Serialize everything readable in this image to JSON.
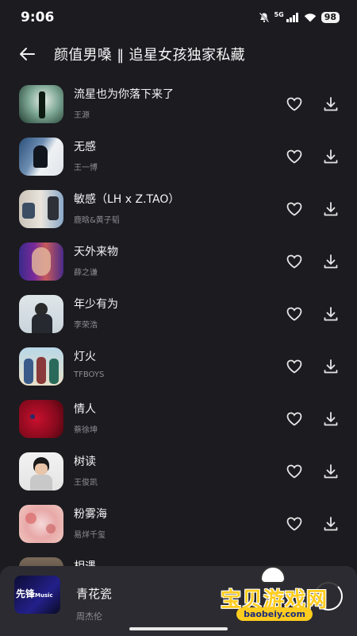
{
  "status_bar": {
    "time": "9:06",
    "network": "5G",
    "battery": "98",
    "icons": [
      "mute-bell-icon",
      "signal-icon",
      "wifi-icon",
      "battery-icon"
    ]
  },
  "header": {
    "back_icon": "arrow-left-icon",
    "title": "颜值男嗓 ‖ 追星女孩独家私藏"
  },
  "songs": [
    {
      "title": "流星也为你落下来了",
      "artist": "王源"
    },
    {
      "title": "无感",
      "artist": "王一博"
    },
    {
      "title": "敏感（LH x Z.TAO）",
      "artist": "鹿晗&黄子韬"
    },
    {
      "title": "天外来物",
      "artist": "薛之谦"
    },
    {
      "title": "年少有为",
      "artist": "李荣浩"
    },
    {
      "title": "灯火",
      "artist": "TFBOYS"
    },
    {
      "title": "情人",
      "artist": "蔡徐坤"
    },
    {
      "title": "树读",
      "artist": "王俊凯"
    },
    {
      "title": "粉雾海",
      "artist": "易烊千玺"
    },
    {
      "title": "相遇",
      "artist": ""
    }
  ],
  "row_icons": {
    "like": "heart-outline-icon",
    "download": "download-icon"
  },
  "player": {
    "logo_text": "先锋",
    "logo_sub": "Music",
    "title": "青花瓷",
    "artist": "周杰伦",
    "control_icon": "play-progress-ring-icon"
  },
  "watermark": {
    "text": "宝贝游戏网",
    "url": "baobeiy.com"
  },
  "colors": {
    "background": "#1c1b20",
    "player_background": "#2c2b31",
    "primary_text": "#f4f4f4",
    "secondary_text": "#8e8d94"
  }
}
